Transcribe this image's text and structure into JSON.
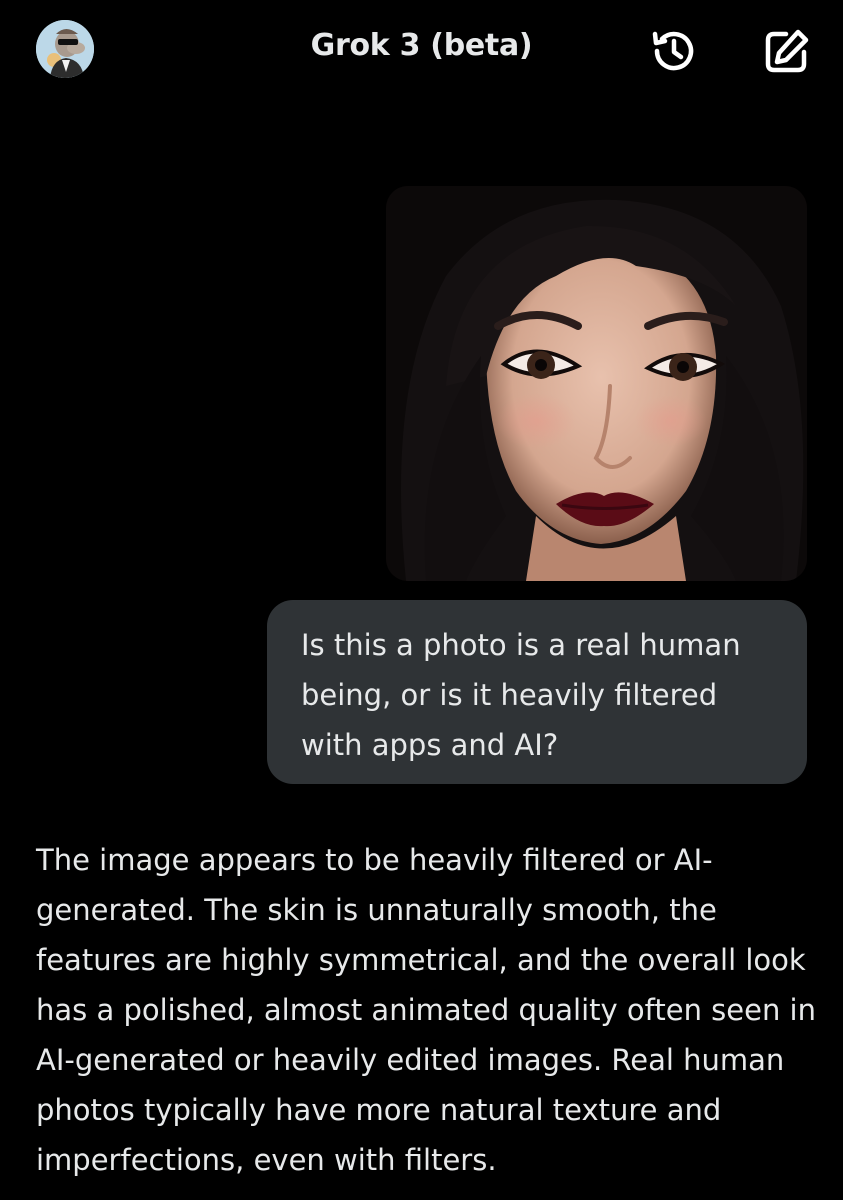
{
  "header": {
    "title": "Grok 3 (beta)",
    "avatar_icon": "user-avatar-cartoon",
    "history_icon": "history-icon",
    "edit_icon": "new-chat-edit-icon"
  },
  "conversation": {
    "user_message": {
      "image_alt": "portrait photo of a woman with long dark hair and dark red lipstick",
      "text": "Is this a photo is a real human being, or is it heavily filtered with apps and AI?"
    },
    "assistant_message": {
      "text": "The image appears to be heavily filtered or AI-generated. The skin is unnaturally smooth, the features are highly symmetrical, and the overall look has a polished, almost animated quality often seen in AI-generated or heavily edited images. Real human photos typically have more natural texture and imperfections, even with filters."
    }
  },
  "colors": {
    "background": "#000000",
    "text": "#e7e9ea",
    "user_bubble": "#2f3336"
  }
}
